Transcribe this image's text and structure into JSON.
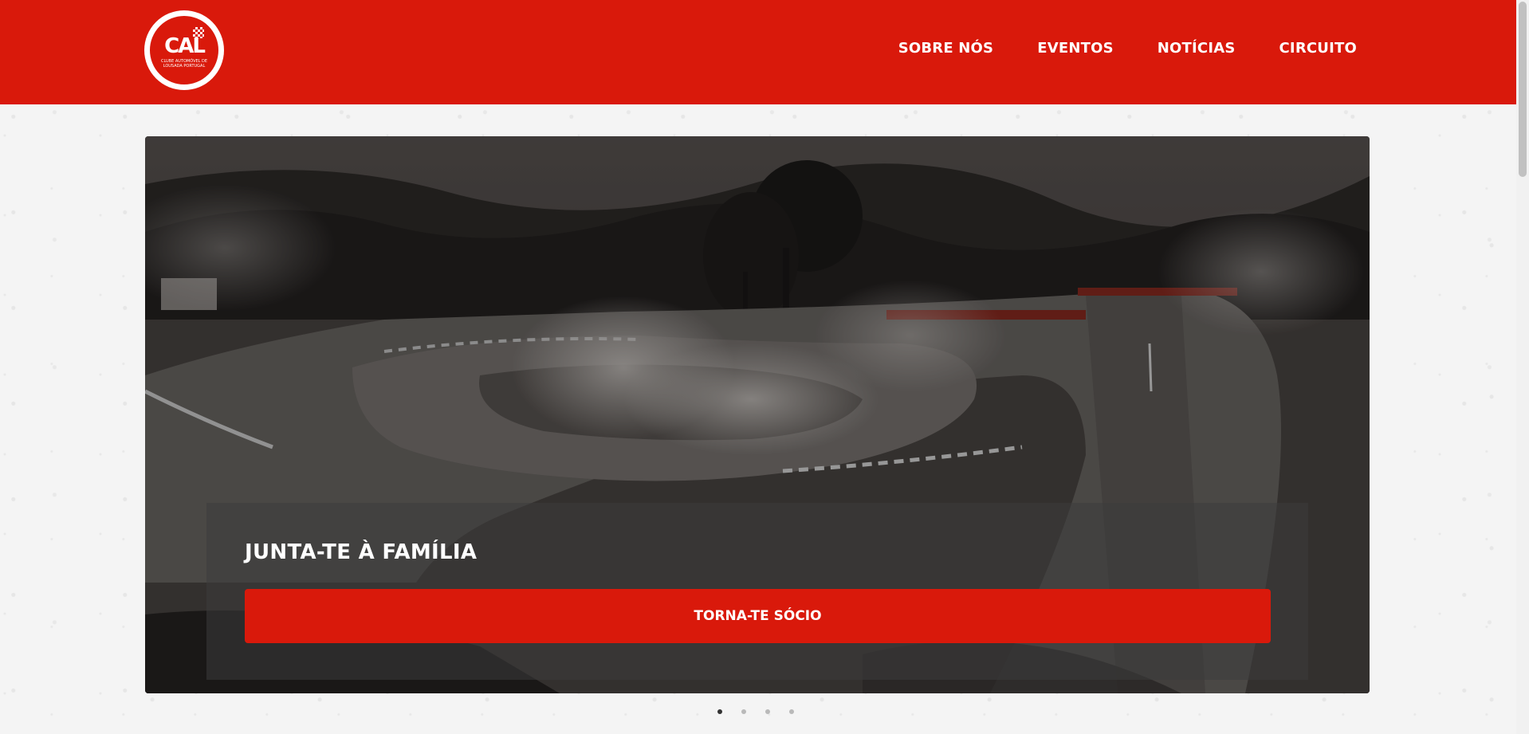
{
  "header": {
    "logo": {
      "mark": "CAL",
      "text": "CLUBE AUTOMÓVEL DE LOUSADA PORTUGAL"
    },
    "nav": [
      {
        "label": "SOBRE NÓS"
      },
      {
        "label": "EVENTOS"
      },
      {
        "label": "NOTÍCIAS"
      },
      {
        "label": "CIRCUITO"
      }
    ]
  },
  "hero": {
    "image_description": "rallycross-circuit-aerial-photo",
    "heading": "JUNTA-TE À FAMÍLIA",
    "cta_label": "TORNA-TE SÓCIO"
  },
  "carousel": {
    "slides": 4,
    "active_index": 0
  },
  "colors": {
    "brand_red": "#d9190b",
    "white": "#ffffff"
  }
}
